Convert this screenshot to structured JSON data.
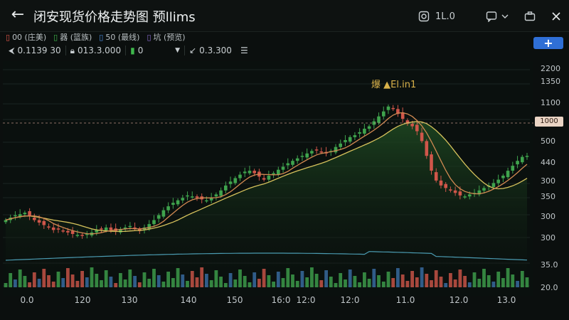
{
  "header": {
    "back_icon": "arrow-left-icon",
    "title": "闭安现货价格走势图 预llims",
    "toolbar_text": "1L.0",
    "icons": [
      "camera-icon",
      "comment-icon",
      "chevron-down-icon",
      "briefcase-icon",
      "close-icon"
    ]
  },
  "legend": [
    {
      "marker": "▯",
      "text": "00 (庄美)",
      "color": "#e0574a"
    },
    {
      "marker": "▯",
      "text": "器 (篮族)",
      "color": "#3fb84c"
    },
    {
      "marker": "▯",
      "text": "50 (最线)",
      "color": "#4a8de0"
    },
    {
      "marker": "▯",
      "text": "坑 (预览)",
      "color": "#8e6fd6"
    }
  ],
  "toolbar": {
    "field1": "0.1139  30",
    "field2": "013.3.000",
    "field3": "0",
    "field4": "0.3.300"
  },
  "add_button": "+",
  "colors": {
    "up": "#3fa34d",
    "down": "#d0564a",
    "volume_blue": "#3a6fa8",
    "ma_yellow": "#d6c25c",
    "ma_orange": "#d28a52",
    "volume_line": "#4a9ab0",
    "area_fill": "#1f4a22"
  },
  "chart_data": {
    "type": "candlestick",
    "y_axis_ticks": [
      "2200",
      "1350",
      "1100",
      "1000",
      "500",
      "440",
      "300",
      "350",
      "300",
      "300",
      "35.0",
      "20.0"
    ],
    "x_axis_ticks": [
      "0.0",
      "120",
      "130",
      "140",
      "150",
      "16:0",
      "12:0",
      "12:0",
      "11.0",
      "12.0",
      "13.0"
    ],
    "last_price_label": "1000",
    "annotation": "爆 ▲El.in1",
    "close_values": [
      290,
      295,
      300,
      302,
      305,
      298,
      290,
      285,
      280,
      275,
      270,
      272,
      268,
      265,
      262,
      260,
      258,
      262,
      265,
      270,
      272,
      275,
      270,
      268,
      272,
      275,
      278,
      272,
      268,
      275,
      282,
      290,
      300,
      310,
      318,
      325,
      330,
      335,
      340,
      338,
      335,
      332,
      330,
      335,
      342,
      350,
      360,
      368,
      375,
      382,
      388,
      390,
      385,
      378,
      372,
      380,
      385,
      392,
      398,
      405,
      410,
      415,
      420,
      425,
      430,
      432,
      428,
      425,
      430,
      438,
      445,
      452,
      458,
      462,
      468,
      475,
      480,
      490,
      500,
      510,
      520,
      515,
      505,
      495,
      485,
      480,
      470,
      450,
      420,
      390,
      370,
      360,
      355,
      350,
      345,
      340,
      338,
      342,
      345,
      350,
      355,
      360,
      365,
      372,
      380,
      390,
      400,
      410,
      418,
      420
    ]
  }
}
